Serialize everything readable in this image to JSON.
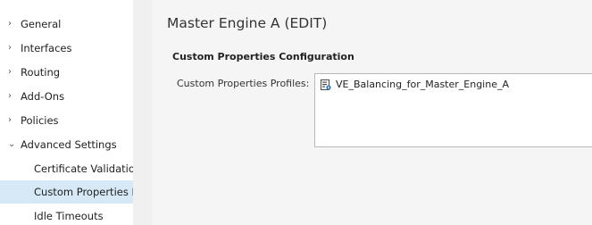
{
  "sidebar": {
    "items": [
      {
        "label": "General",
        "expanded": false
      },
      {
        "label": "Interfaces",
        "expanded": false
      },
      {
        "label": "Routing",
        "expanded": false
      },
      {
        "label": "Add-Ons",
        "expanded": false
      },
      {
        "label": "Policies",
        "expanded": false
      },
      {
        "label": "Advanced Settings",
        "expanded": true
      },
      {
        "label": "Certificate Validation",
        "sub": true
      },
      {
        "label": "Custom Properties Profiles",
        "sub": true,
        "selected": true
      },
      {
        "label": "Idle Timeouts",
        "sub": true
      }
    ]
  },
  "main": {
    "title": "Master Engine A (EDIT)",
    "section_title": "Custom Properties Configuration",
    "field_label": "Custom Properties Profiles:",
    "profiles": [
      {
        "name": "VE_Balancing_for_Master_Engine_A",
        "icon": "profile-list-icon"
      }
    ]
  },
  "colors": {
    "selected_bg": "#d7e9f6",
    "panel_bg": "#f5f5f5",
    "divider_bg": "#f0f0f0"
  }
}
